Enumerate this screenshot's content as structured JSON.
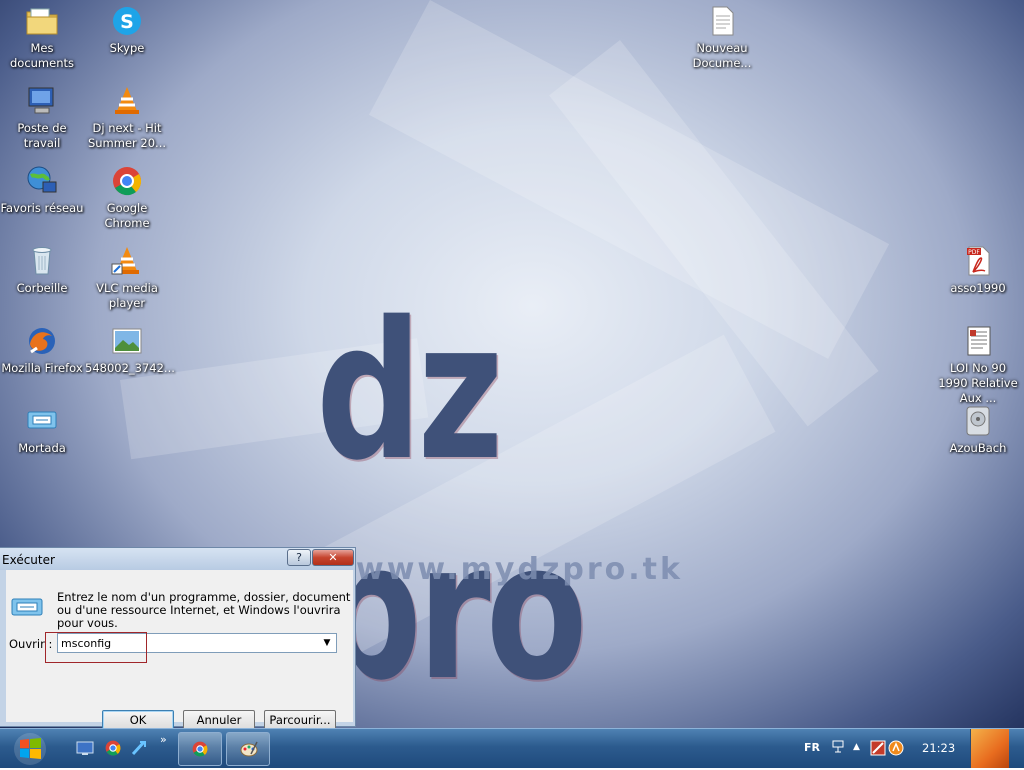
{
  "desktop": {
    "wallpaper": {
      "logo_text": "dz pro",
      "url_text": "www.mydzpro.tk"
    },
    "icons": [
      {
        "label": "Mes documents",
        "icon": "folder-documents-icon"
      },
      {
        "label": "Skype",
        "icon": "skype-icon"
      },
      {
        "label": "Poste de travail",
        "icon": "computer-icon"
      },
      {
        "label": "Dj next - Hit Summer 20...",
        "icon": "vlc-media-icon"
      },
      {
        "label": "Favoris réseau",
        "icon": "network-icon"
      },
      {
        "label": "Google Chrome",
        "icon": "chrome-icon"
      },
      {
        "label": "Corbeille",
        "icon": "recycle-bin-icon"
      },
      {
        "label": "VLC media player",
        "icon": "vlc-icon"
      },
      {
        "label": "Mozilla Firefox",
        "icon": "firefox-icon"
      },
      {
        "label": "548002_3742...",
        "icon": "image-file-icon"
      },
      {
        "label": "Mortada",
        "icon": "mortada-app-icon"
      },
      {
        "label": "Nouveau Docume...",
        "icon": "text-document-icon"
      },
      {
        "label": "asso1990",
        "icon": "pdf-icon"
      },
      {
        "label": "LOI No 90 1990 Relative Aux ...",
        "icon": "word-document-icon"
      },
      {
        "label": "AzouBach",
        "icon": "disk-image-icon"
      }
    ]
  },
  "run_dialog": {
    "title": "Exécuter",
    "help_label": "?",
    "close_label": "✕",
    "description": "Entrez le nom d'un programme, dossier, document ou d'une ressource Internet, et Windows l'ouvrira pour vous.",
    "open_label": "Ouvrir :",
    "open_value": "msconfig",
    "ok_label": "OK",
    "cancel_label": "Annuler",
    "browse_label": "Parcourir..."
  },
  "taskbar": {
    "quick_launch": [
      "show-desktop-icon",
      "chrome-icon",
      "skype-icon"
    ],
    "more_label": "»",
    "task_buttons": [
      "chrome-icon",
      "paint-icon"
    ],
    "language": "FR",
    "tray_expand": "▲",
    "clock": "21:23"
  },
  "colors": {
    "taskbar": "#2c5b8e",
    "dialog_frame": "#c3d3e6",
    "close_button": "#c6452f",
    "focus_outline": "#a0262a"
  }
}
